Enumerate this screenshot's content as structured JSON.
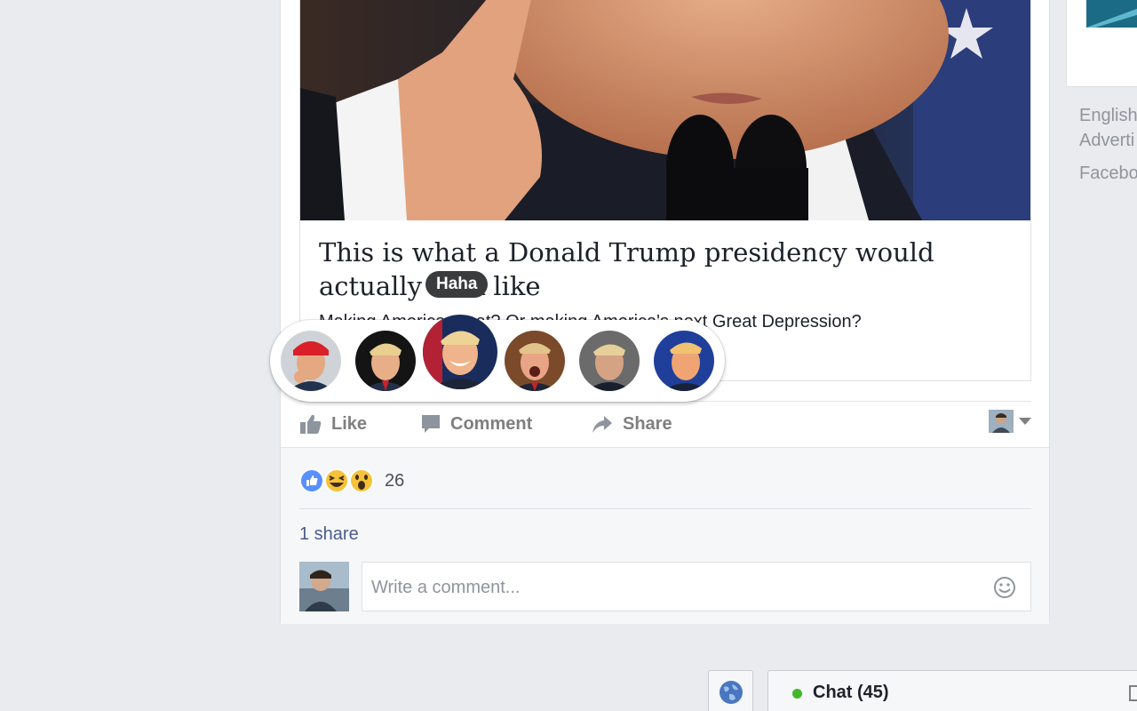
{
  "post": {
    "link_title": "This is what a Donald Trump presidency would actually look like",
    "link_description": "Making America great? Or making America's next Great Depression?",
    "link_domain": ""
  },
  "reaction_picker": {
    "tooltip": "Haha",
    "faces": [
      "like",
      "love",
      "haha",
      "wow",
      "sad",
      "angry"
    ],
    "hovered": "haha"
  },
  "actions": {
    "like_label": "Like",
    "comment_label": "Comment",
    "share_label": "Share"
  },
  "engagement": {
    "reaction_icons": [
      "like-reaction",
      "haha-reaction",
      "wow-reaction"
    ],
    "reaction_count": "26",
    "share_count_label": "1 share"
  },
  "comment": {
    "placeholder": "Write a comment..."
  },
  "sidebar": {
    "links": [
      "English",
      "Adverti",
      "Facebo"
    ]
  },
  "chat": {
    "label": "Chat (45)",
    "status_color": "#42b72a"
  },
  "colors": {
    "background": "#e9ebee",
    "link_blue": "#4b5b8b",
    "tooltip_bg": "#3a3b3c"
  }
}
